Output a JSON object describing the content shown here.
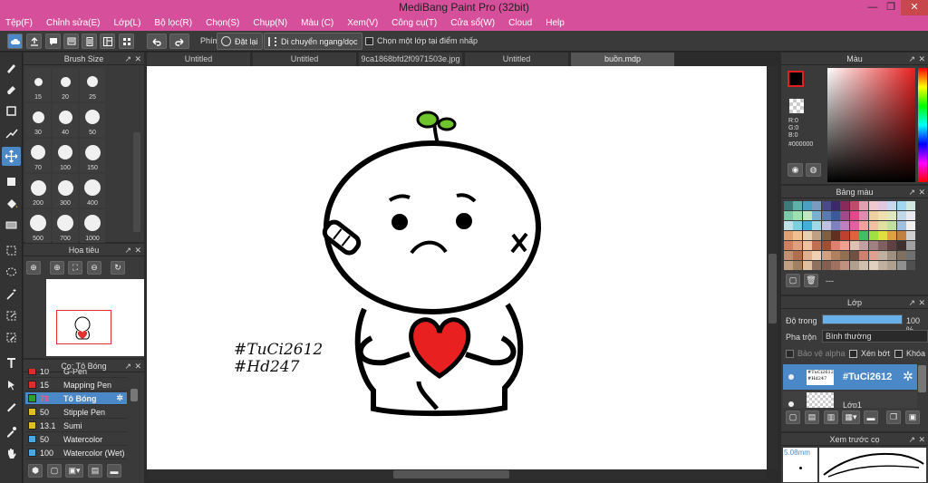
{
  "window": {
    "title": "MediBang Paint Pro (32bit)",
    "min": "—",
    "max": "❐",
    "close": "✕"
  },
  "menu": [
    "Tệp(F)",
    "Chỉnh sửa(E)",
    "Lớp(L)",
    "Bộ lọc(R)",
    "Chọn(S)",
    "Chụp(N)",
    "Màu (C)",
    "Xem(V)",
    "Công cụ(T)",
    "Cửa sổ(W)",
    "Cloud",
    "Help"
  ],
  "toolbar": {
    "phim_label": "Phím",
    "reset_label": "Đặt lại",
    "flip_label": "Di chuyển ngang/dọc",
    "select_one_layer_label": "Chọn một lớp tại điểm nhấp"
  },
  "brush_size_panel": {
    "title": "Brush Size",
    "sizes": [
      "15",
      "20",
      "25",
      "30",
      "40",
      "50",
      "70",
      "100",
      "150",
      "200",
      "300",
      "400",
      "500",
      "700",
      "1000"
    ]
  },
  "navigator_panel": {
    "title": "Họa tiêu"
  },
  "brush_panel": {
    "title": "Cọ: Tô Bóng",
    "items": [
      {
        "size": "10",
        "name": "G-Pen",
        "color": "#e02c2c"
      },
      {
        "size": "15",
        "name": "Mapping Pen",
        "color": "#e02c2c"
      },
      {
        "size": "70",
        "name": "Tô Bóng",
        "color": "#2ea02e",
        "selected": true
      },
      {
        "size": "50",
        "name": "Stipple Pen",
        "color": "#e0c020"
      },
      {
        "size": "13.1",
        "name": "Sumi",
        "color": "#e0c020"
      },
      {
        "size": "50",
        "name": "Watercolor",
        "color": "#4aa8e0"
      },
      {
        "size": "100",
        "name": "Watercolor (Wet)",
        "color": "#4aa8e0"
      }
    ]
  },
  "tabs": [
    {
      "label": "Untitled"
    },
    {
      "label": "Untitled"
    },
    {
      "label": "9ca1868bfd2f0971503e.jpg"
    },
    {
      "label": "Untitled"
    },
    {
      "label": "buồn.mdp",
      "active": true
    }
  ],
  "canvas": {
    "text_line1": "#TuCi2612",
    "text_line2": "#Hd247"
  },
  "color_panel": {
    "title": "Màu",
    "r": "R:0",
    "g": "G:0",
    "b": "B:0",
    "hex": "#000000"
  },
  "palette_panel": {
    "title": "Bảng màu",
    "name": "---",
    "colors": [
      "#3d7a7a",
      "#5fb0a8",
      "#4aa0c0",
      "#7a9ac0",
      "#4a4a8a",
      "#3a2a6a",
      "#8a2a5a",
      "#c04a6a",
      "#e0a0b0",
      "#f0c8d0",
      "#e0c8e0",
      "#c8d8f0",
      "#a0d8f0",
      "#d0e8e0",
      "#7ac8a8",
      "#a0e0b0",
      "#c0e8c0",
      "#7ab0d0",
      "#5a7ab0",
      "#3a5a9a",
      "#a04a8a",
      "#e04a8a",
      "#e08ab0",
      "#f0d0a0",
      "#f0e0b0",
      "#e0e8c0",
      "#c0d8e8",
      "#e8e8f0",
      "#c0e0e8",
      "#7ad0e0",
      "#40b0d8",
      "#a0d8e8",
      "#c0c0e0",
      "#8080c0",
      "#c080c0",
      "#e060a0",
      "#f0a0a0",
      "#f0c0a0",
      "#e0e0a0",
      "#c0e0a0",
      "#a0c0e0",
      "#f0f0f0",
      "#e0a070",
      "#f0c090",
      "#e8d0b0",
      "#c0a080",
      "#806040",
      "#603020",
      "#c04030",
      "#e06040",
      "#40c060",
      "#a0e040",
      "#e0e040",
      "#e0a040",
      "#c08040",
      "#d0d0d0",
      "#d08060",
      "#e0a080",
      "#f0c0a0",
      "#c07050",
      "#a05030",
      "#e08070",
      "#f0a090",
      "#e0c0b0",
      "#c0a0a0",
      "#a08080",
      "#806060",
      "#604040",
      "#403030",
      "#a0a0a0",
      "#c09070",
      "#b07050",
      "#e0b090",
      "#f0d0b0",
      "#d0a080",
      "#b08060",
      "#907050",
      "#705040",
      "#d08070",
      "#e0a090",
      "#c0b0a0",
      "#a09080",
      "#807060",
      "#707070",
      "#c0a080",
      "#a08060",
      "#e0c0a0",
      "#907060",
      "#806050",
      "#a07060",
      "#c09080",
      "#b0a090",
      "#d0c0b0",
      "#e0d0c0",
      "#c0b0a0",
      "#b0a090",
      "#909090",
      "#505050"
    ]
  },
  "layer_panel": {
    "title": "Lớp",
    "opacity_label": "Độ trong",
    "opacity_value": "100 %",
    "opacity_fraction": 1.0,
    "blend_label": "Pha trộn",
    "blend_value": "Bình thường",
    "protect_alpha": "Bảo vệ alpha",
    "clipping": "Xén bớt",
    "lock": "Khóa",
    "layers": [
      {
        "name": "#TuCi2612",
        "selected": true
      },
      {
        "name": "Lớp1",
        "selected": false
      }
    ]
  },
  "brush_preview_panel": {
    "title": "Xem trước cọ",
    "size": "5.08mm"
  }
}
